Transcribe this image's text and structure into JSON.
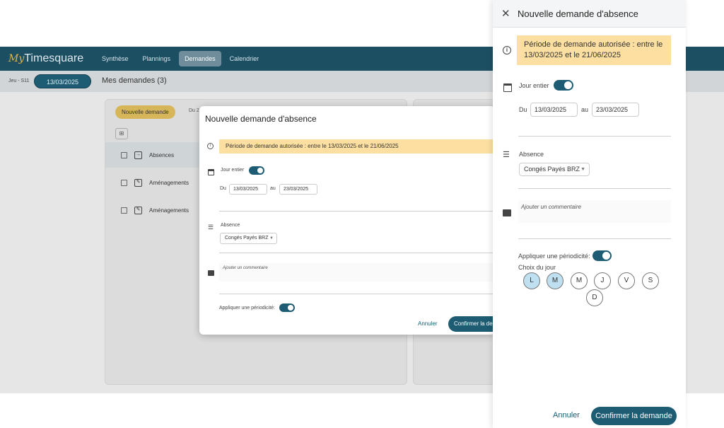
{
  "app": {
    "logo_prefix": "My",
    "logo_name": "Timesquare",
    "nav": [
      "Synthèse",
      "Plannings",
      "Demandes",
      "Calendrier"
    ],
    "week_label": "Jeu - S11",
    "current_date": "13/03/2025",
    "page_title": "Mes demandes (3)",
    "new_request_button": "Nouvelle demande",
    "du_label": "Du 2",
    "rows": [
      "Absences",
      "Aménagements",
      "Aménagements"
    ]
  },
  "modal": {
    "title": "Nouvelle demande d'absence",
    "info": "Période de demande autorisée : entre le 13/03/2025 et le 21/06/2025",
    "jour_entier": "Jour entier",
    "du": "Du",
    "from_date": "13/03/2025",
    "au": "au",
    "to_date": "23/03/2025",
    "absence_label": "Absence",
    "absence_value": "Congés Payés BRZ",
    "comment_placeholder": "Ajouter un commentaire",
    "periodicite": "Appliquer une périodicité:",
    "annuler": "Annuler",
    "confirmer": "Confirmer la demande"
  },
  "drawer": {
    "title": "Nouvelle demande d'absence",
    "info": "Période de demande autorisée : entre le 13/03/2025 et le 21/06/2025",
    "jour_entier": "Jour entier",
    "du": "Du",
    "from_date": "13/03/2025",
    "au": "au",
    "to_date": "23/03/2025",
    "absence_label": "Absence",
    "absence_value": "Congés Payés BRZ",
    "comment_placeholder": "Ajouter un commentaire",
    "periodicite": "Appliquer une périodicité:",
    "choix_jour": "Choix du jour",
    "days": [
      "L",
      "M",
      "M",
      "J",
      "V",
      "S",
      "D"
    ],
    "selected_days": [
      "L",
      "M"
    ],
    "annuler": "Annuler",
    "confirmer": "Confirmer la demande"
  },
  "colors": {
    "primary": "#1d5c73",
    "topbar": "#1d4f63",
    "info_bg": "#fde0a1",
    "day_selected": "#bfe0f1"
  }
}
